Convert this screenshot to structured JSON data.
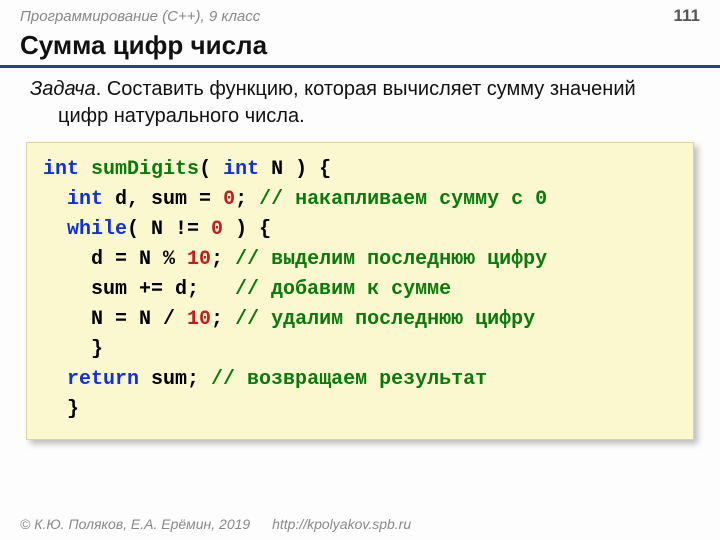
{
  "header": {
    "course": "Программирование (C++), 9 класс",
    "page": "111"
  },
  "title": "Сумма цифр числа",
  "task": {
    "lead": "Задача",
    "body": ". Составить функцию, которая вычисляет сумму значений цифр натурального числа."
  },
  "code": {
    "l1": {
      "kw1": "int",
      "fn": "sumDigits",
      "p1": "( ",
      "kw2": "int",
      "p2": " N ) {"
    },
    "l2": {
      "ind": "  ",
      "kw": "int",
      "t1": " d, sum = ",
      "num": "0",
      "t2": "; ",
      "cm": "// накапливаем сумму с 0"
    },
    "l3": {
      "ind": "  ",
      "kw": "while",
      "t1": "( N != ",
      "num": "0",
      "t2": " ) {"
    },
    "l4": {
      "ind": "    ",
      "t1": "d = N % ",
      "num": "10",
      "t2": "; ",
      "cm": "// выделим последнюю цифру"
    },
    "l5": {
      "ind": "    ",
      "t1": "sum += d;   ",
      "cm": "// добавим к сумме"
    },
    "l6": {
      "ind": "    ",
      "t1": "N = N / ",
      "num": "10",
      "t2": "; ",
      "cm": "// удалим последнюю цифру"
    },
    "l7": {
      "ind": "    ",
      "t": "}"
    },
    "l8": {
      "ind": "  ",
      "kw": "return",
      "t1": " sum; ",
      "cm": "// возвращаем результат"
    },
    "l9": {
      "ind": "  ",
      "t": "}"
    }
  },
  "footer": {
    "copyright": "© К.Ю. Поляков, Е.А. Ерёмин, 2019",
    "link": "http://kpolyakov.spb.ru"
  }
}
